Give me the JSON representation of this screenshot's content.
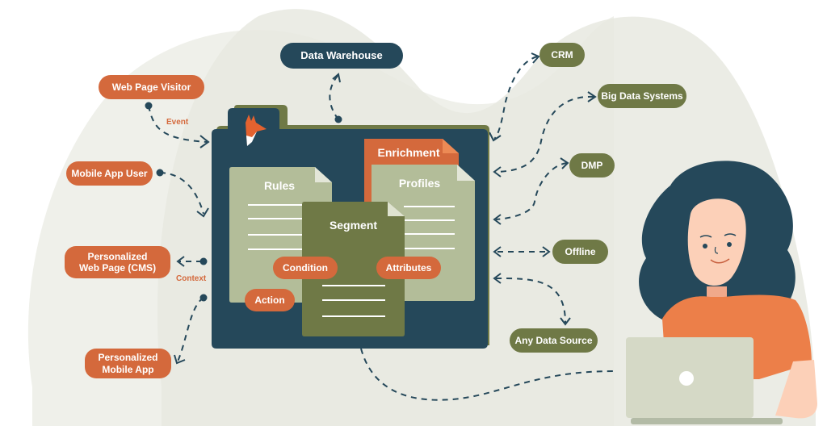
{
  "colors": {
    "orange": "#d4693c",
    "olive": "#6f7946",
    "navy": "#25485a",
    "sage": "#b3bd99",
    "background_blob": "#eaebe3",
    "skin": "#fcd0b8",
    "shirt": "#ec7f49",
    "laptop": "#d5d9c6"
  },
  "inputs": {
    "web_page_visitor": "Web Page Visitor",
    "mobile_app_user": "Mobile App User",
    "event_label": "Event"
  },
  "outputs": {
    "personalized_web_page": "Personalized\nWeb Page (CMS)",
    "personalized_mobile_app": "Personalized\nMobile App",
    "context_label": "Context"
  },
  "top": {
    "data_warehouse": "Data Warehouse"
  },
  "sources": {
    "crm": "CRM",
    "big_data": "Big Data Systems",
    "dmp": "DMP",
    "offline": "Offline",
    "any_source": "Any Data Source"
  },
  "folder": {
    "logo_icon": "fox-logo-icon",
    "enrichment": "Enrichment",
    "rules": "Rules",
    "profiles": "Profiles",
    "segment": "Segment",
    "condition": "Condition",
    "attributes": "Attributes",
    "action": "Action"
  },
  "illustration": {
    "person": "woman-with-laptop"
  }
}
